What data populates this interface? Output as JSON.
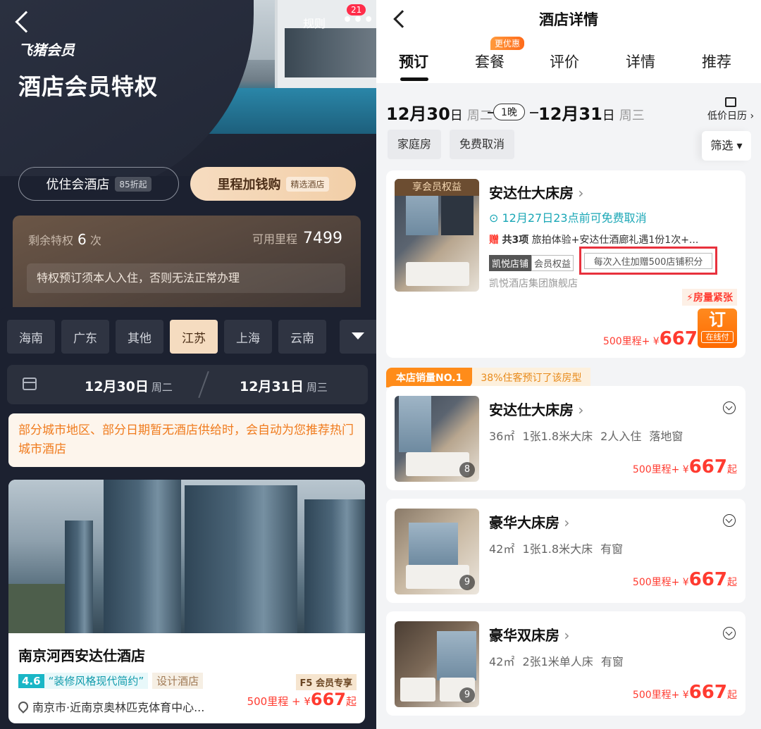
{
  "left": {
    "header": {
      "rules": "规则",
      "more_badge": "21",
      "brand": "飞猪会员",
      "title": "酒店会员特权"
    },
    "tabs": [
      {
        "label": "优住会酒店",
        "badge": "85折起"
      },
      {
        "label": "里程加钱购",
        "badge": "精选酒店"
      }
    ],
    "benefit": {
      "remaining_label": "剩余特权",
      "remaining_value": "6",
      "remaining_unit": "次",
      "miles_label": "可用里程",
      "miles_value": "7499",
      "note": "特权预订须本人入住，否则无法正常办理"
    },
    "cities": [
      "海南",
      "广东",
      "其他",
      "江苏",
      "上海",
      "云南"
    ],
    "selected_city": "江苏",
    "dates": {
      "checkin": "12月30日",
      "checkin_week": "周二",
      "checkout": "12月31日",
      "checkout_week": "周三"
    },
    "notice": "部分城市地区、部分日期暂无酒店供给时，会自动为您推荐热门城市酒店",
    "hotel": {
      "name": "南京河西安达仕酒店",
      "score": "4.6",
      "quote": "“装修风格现代简约”",
      "type": "设计酒店",
      "location": "南京市·近南京奥林匹克体育中心...",
      "f5": "F5 会员专享",
      "price_prefix": "500里程 + ¥",
      "price": "667",
      "price_suffix": "起"
    }
  },
  "right": {
    "title": "酒店详情",
    "tabs": [
      "预订",
      "套餐",
      "评价",
      "详情",
      "推荐"
    ],
    "tab_badge": "更优惠",
    "dates": {
      "checkin_day": "12月30",
      "checkin_suffix": "日",
      "checkin_week": "周二",
      "nights": "1晚",
      "checkout_day": "12月31",
      "checkout_suffix": "日",
      "checkout_week": "周三",
      "calendar": "低价日历"
    },
    "chips": [
      "家庭房",
      "免费取消"
    ],
    "filter": "筛选",
    "featured": {
      "vip": "享会员权益",
      "name": "安达仕大床房",
      "cancel": "12月27日23点前可免费取消",
      "gift_tag": "赠",
      "gift_count": "共3项",
      "gift_text": "旅拍体验+安达仕酒廊礼遇1份1次+...",
      "tag1": "凯悦店铺",
      "tag2": "会员权益",
      "tag3": "每次入住加赠500店铺积分",
      "brand": "凯悦酒店集团旗舰店",
      "tight": "房量紧张",
      "price_prefix": "500里程+ ¥",
      "price": "667",
      "book": "订",
      "online": "在线付"
    },
    "sales": {
      "a": "本店销量NO.1",
      "b": "38%住客预订了该房型"
    },
    "rooms": [
      {
        "name": "安达仕大床房",
        "spec": "36㎡ 1张1.8米大床 2人入住 落地窗",
        "photos": "8",
        "price_prefix": "500里程+ ¥",
        "price": "667",
        "suffix": "起"
      },
      {
        "name": "豪华大床房",
        "spec": "42㎡ 1张1.8米大床 有窗",
        "photos": "9",
        "price_prefix": "500里程+ ¥",
        "price": "667",
        "suffix": "起"
      },
      {
        "name": "豪华双床房",
        "spec": "42㎡ 2张1米单人床 有窗",
        "photos": "9",
        "price_prefix": "500里程+ ¥",
        "price": "667",
        "suffix": "起"
      }
    ]
  }
}
